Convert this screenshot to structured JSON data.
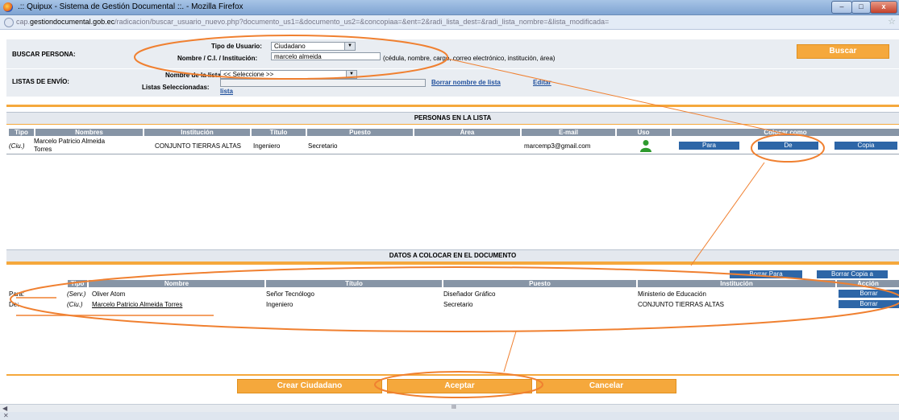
{
  "window": {
    "title": ".:: Quipux - Sistema de Gestión Documental ::. - Mozilla Firefox",
    "min_label": "–",
    "max_label": "□",
    "close_label": "x"
  },
  "address": {
    "pre": "cap.",
    "domain": "gestiondocumental.gob.ec",
    "path": "/radicacion/buscar_usuario_nuevo.php?documento_us1=&documento_us2=&concopiaa=&ent=2&radi_lista_dest=&radi_lista_nombre=&lista_modificada="
  },
  "buscar": {
    "section_label": "BUSCAR PERSONA:",
    "tipo_label": "Tipo de Usuario:",
    "tipo_value": "Ciudadano",
    "nombre_label": "Nombre / C.I. / Institución:",
    "nombre_value": "marcelo almeida",
    "hint": "(cédula, nombre, cargo, correo electrónico, institución, área)",
    "buscar_button": "Buscar"
  },
  "listas": {
    "section_label": "LISTAS DE ENVÍO:",
    "nombre_lista_label": "Nombre de la lista:",
    "nombre_lista_value": "<< Seleccione >>",
    "seleccionadas_label": "Listas Seleccionadas:",
    "seleccionadas_value": "",
    "lista_link": "lista",
    "borrar_link": "Borrar nombre de lista",
    "editar_link": "Editar"
  },
  "personas": {
    "title": "PERSONAS EN LA LISTA",
    "headers": [
      "Tipo",
      "Nombres",
      "Institución",
      "Título",
      "Puesto",
      "Área",
      "E-mail",
      "Uso",
      "Colocar como"
    ],
    "row": {
      "tipo": "(Ciu.)",
      "nombre_1": "Marcelo Patricio Almeida",
      "nombre_2": "Torres",
      "institucion": "CONJUNTO TIERRAS ALTAS",
      "titulo": "Ingeniero",
      "puesto": "Secretario",
      "area": "",
      "email": "marcemp3@gmail.com",
      "para": "Para",
      "de": "De",
      "copia": "Copia"
    }
  },
  "datos": {
    "title": "DATOS A COLOCAR EN EL DOCUMENTO",
    "borrar_para": "Borrar Para",
    "borrar_copia": "Borrar Copia a",
    "headers": [
      "Tipo",
      "Nombre",
      "Título",
      "Puesto",
      "Institución",
      "Acción"
    ],
    "rows": [
      {
        "rol": "Para:",
        "tipo": "(Serv.)",
        "nombre": "Oliver Atom",
        "titulo": "Señor Tecnólogo",
        "puesto": "Diseñador Gráfico",
        "institucion": "Ministerio de Educación",
        "accion": "Borrar"
      },
      {
        "rol": "De:",
        "tipo": "(Ciu.)",
        "nombre": "Marcelo Patricio Almeida Torres",
        "titulo": "Ingeniero",
        "puesto": "Secretario",
        "institucion": "CONJUNTO TIERRAS ALTAS",
        "accion": "Borrar"
      }
    ]
  },
  "bottom": {
    "crear": "Crear Ciudadano",
    "aceptar": "Aceptar",
    "cancelar": "Cancelar"
  },
  "scroll": {
    "thumb": "III"
  },
  "status": {
    "close": "✕"
  },
  "colors": {
    "orange": "#f5a83c",
    "blue_button": "#2d66a7",
    "header_gray": "#8795a6",
    "annotation": "#f08030"
  }
}
